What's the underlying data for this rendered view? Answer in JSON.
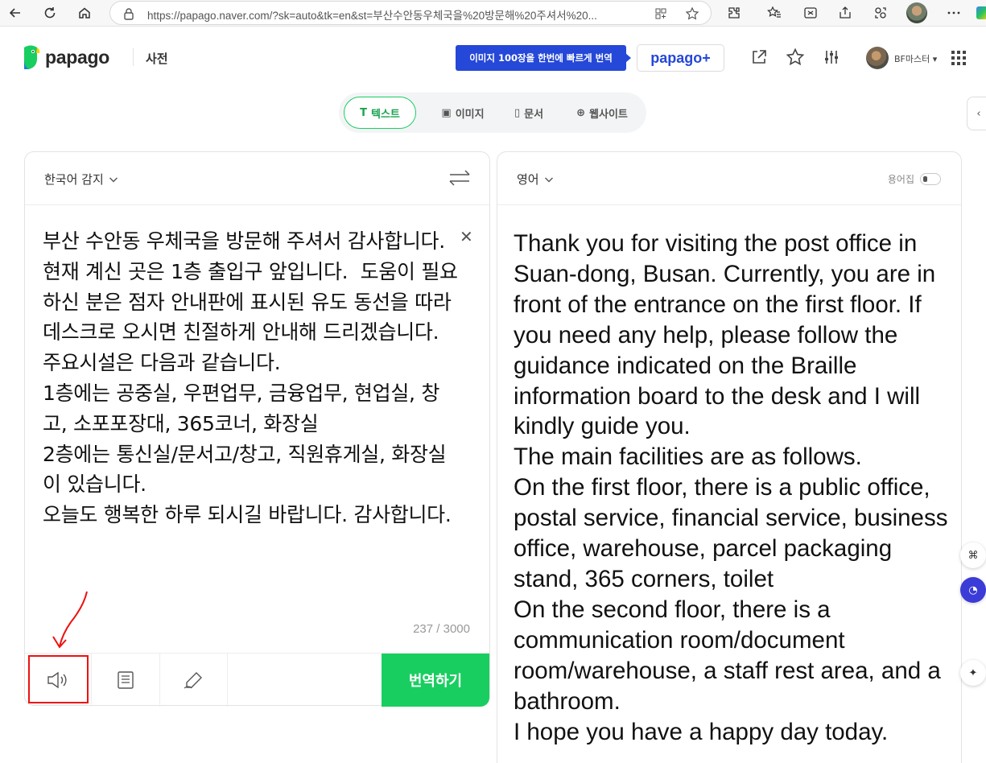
{
  "browser": {
    "url": "https://papago.naver.com/?sk=auto&tk=en&st=부산수안동우체국을%20방문해%20주셔서%20..."
  },
  "header": {
    "logo_text": "papago",
    "dict_link": "사전",
    "promo_text": "이미지 100장을 한번에 빠르게 번역",
    "plus_label": "papago+",
    "user_name": "BF마스터",
    "user_caret": "▾"
  },
  "mode_tabs": [
    {
      "label": "텍스트",
      "glyph": "T",
      "active": true
    },
    {
      "label": "이미지",
      "glyph": "▣",
      "active": false
    },
    {
      "label": "문서",
      "glyph": "▯",
      "active": false
    },
    {
      "label": "웹사이트",
      "glyph": "⊕",
      "active": false
    }
  ],
  "source": {
    "language": "한국어 감지",
    "text": "부산 수안동 우체국을 방문해 주셔서 감사합니다. 현재 계신 곳은 1층 출입구 앞입니다.  도움이 필요하신 분은 점자 안내판에 표시된 유도 동선을 따라 데스크로 오시면 친절하게 안내해 드리겠습니다.\n주요시설은 다음과 같습니다.\n1층에는 공중실, 우편업무, 금융업무, 현업실, 창고, 소포포장대, 365코너, 화장실\n2층에는 통신실/문서고/창고, 직원휴게실, 화장실이 있습니다.\n오늘도 행복한 하루 되시길 바랍니다. 감사합니다.",
    "char_count": "237 / 3000",
    "translate_button": "번역하기"
  },
  "target": {
    "language": "영어",
    "glossary_label": "용어집",
    "text": "Thank you for visiting the post office in Suan-dong, Busan. Currently, you are in front of the entrance on the first floor. If you need any help, please follow the guidance indicated on the Braille information board to the desk and I will kindly guide you.\nThe main facilities are as follows.\nOn the first floor, there is a public office, postal service, financial service, business office, warehouse, parcel packaging stand, 365 corners, toilet\nOn the second floor, there is a communication room/document room/warehouse, a staff rest area, and a bathroom.\nI hope you have a happy day today."
  },
  "colors": {
    "accent_green": "#19ce60",
    "promo_blue": "#2548d8",
    "annotation_red": "#ee1111"
  }
}
